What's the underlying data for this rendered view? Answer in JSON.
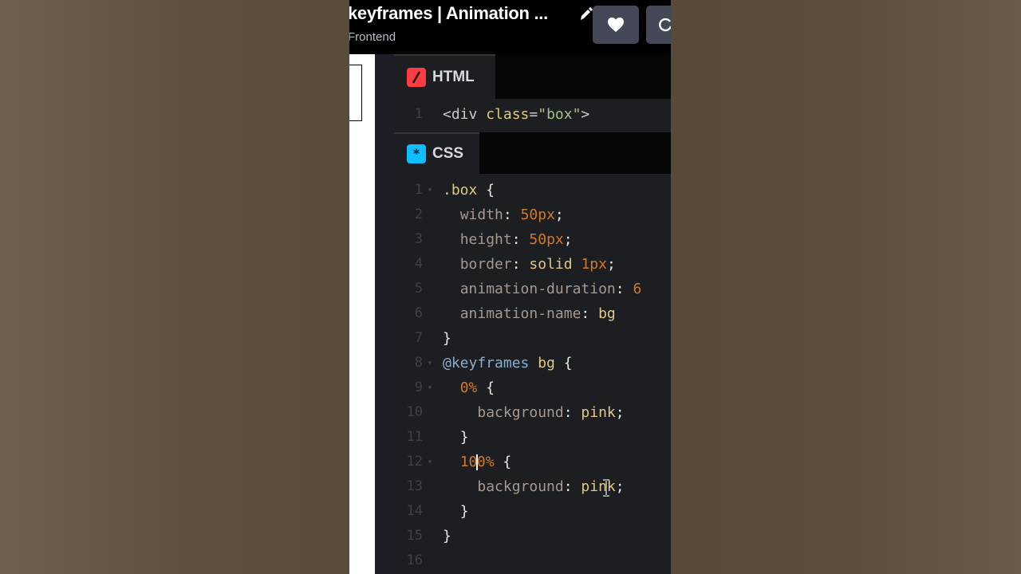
{
  "header": {
    "title": "keyframes | Animation ...",
    "subtitle": "Frontend"
  },
  "html_pane": {
    "label": "HTML",
    "icon_color": "#ff3c41",
    "lines": [
      {
        "n": "1",
        "text": "<div class=\"box\">"
      }
    ]
  },
  "css_pane": {
    "label": "CSS",
    "icon_color": "#0ebeff",
    "lines": [
      {
        "n": "1",
        "text": ".box {"
      },
      {
        "n": "2",
        "text": "  width: 50px;"
      },
      {
        "n": "3",
        "text": "  height: 50px;"
      },
      {
        "n": "4",
        "text": "  border: solid 1px;"
      },
      {
        "n": "5",
        "text": "  animation-duration: 6"
      },
      {
        "n": "6",
        "text": "  animation-name: bg"
      },
      {
        "n": "7",
        "text": "}"
      },
      {
        "n": "8",
        "text": "@keyframes bg {"
      },
      {
        "n": "9",
        "text": "  0% {"
      },
      {
        "n": "10",
        "text": "    background: pink;"
      },
      {
        "n": "11",
        "text": "  }"
      },
      {
        "n": "12",
        "text": "  100% {"
      },
      {
        "n": "13",
        "text": "    background: pink;"
      },
      {
        "n": "14",
        "text": "  }"
      },
      {
        "n": "15",
        "text": "}"
      },
      {
        "n": "16",
        "text": ""
      }
    ]
  }
}
